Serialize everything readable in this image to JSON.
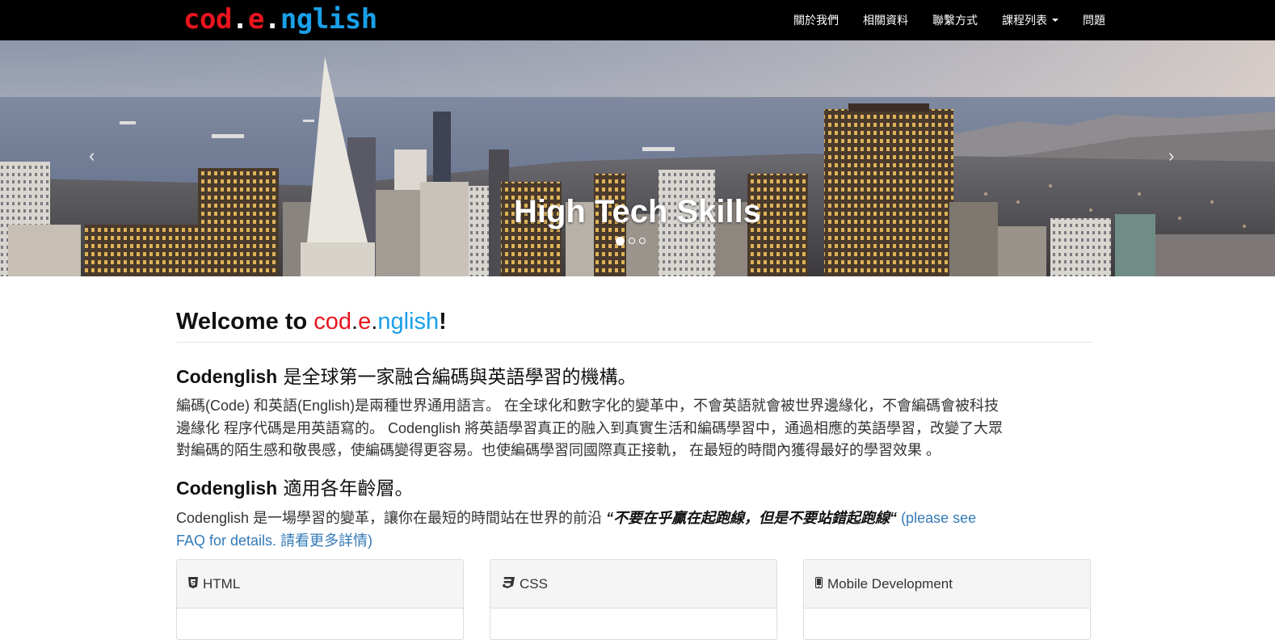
{
  "navbar": {
    "brand": {
      "part1": "cod",
      "dot1": ".",
      "part2": "e",
      "dot2": ".",
      "part3": "nglish"
    },
    "links": [
      "關於我們",
      "相關資料",
      "聯繫方式",
      "課程列表",
      "問題"
    ]
  },
  "carousel": {
    "caption": "High Tech Skills",
    "prev": "‹",
    "next": "›",
    "slide_count": 3,
    "active_slide": 1
  },
  "main": {
    "welcome": {
      "prefix": "Welcome to ",
      "logo1": "cod",
      "dot1": ".",
      "logo2": "e",
      "dot2": ".",
      "logo3": "nglish",
      "suffix": "!"
    },
    "heading1": {
      "brand": "Codenglish",
      "text": " 是全球第一家融合編碼與英語學習的機構。"
    },
    "para1": [
      "編碼(Code) 和英語(English)是兩種世界通用語言。 在全球化和數字化的變革中，不會英語就會被世界邊緣化，不會編碼會被科技",
      "邊緣化 程序代碼是用英語寫的。 Codenglish 將英語學習真正的融入到真實生活和編碼學習中，通過相應的英語學習，改變了大眾",
      "對編碼的陌生感和敬畏感，使編碼變得更容易。也使編碼學習同國際真正接軌， 在最短的時間內獲得最好的學習效果 。"
    ],
    "heading2": {
      "brand": "Codenglish",
      "text": " 適用各年齡層。"
    },
    "para2": {
      "text": "Codenglish 是一場學習的變革，讓你在最短的時間站在世界的前沿 ",
      "quote": "“不要在乎贏在起跑線，但是不要站錯起跑線“",
      "link_line1": " (please see",
      "link_line2": "FAQ for details. 請看更多詳情)"
    },
    "panels": [
      {
        "icon": "html5-icon",
        "title": "HTML"
      },
      {
        "icon": "css3-icon",
        "title": "CSS"
      },
      {
        "icon": "mobile-icon",
        "title": "Mobile Development"
      }
    ]
  },
  "colors": {
    "red": "#e8141e",
    "blue": "#1aa0e8",
    "link": "#337ab7",
    "navbar": "#000000"
  }
}
